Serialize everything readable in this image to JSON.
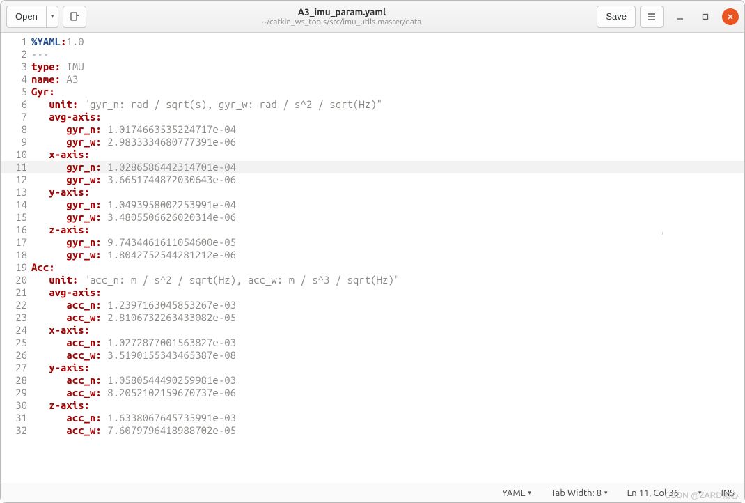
{
  "header": {
    "open": "Open",
    "save": "Save",
    "title": "A3_imu_param.yaml",
    "subtitle": "~/catkin_ws_tools/src/imu_utils-master/data"
  },
  "status": {
    "lang": "YAML",
    "tab": "Tab Width: 8",
    "pos": "Ln 11, Col 36",
    "ins": "INS"
  },
  "watermark": "CSDN @ZARD帧心",
  "code": {
    "directive": "%YAML",
    "version": "1.0",
    "dashes": "---",
    "type_k": "type",
    "type_v": "IMU",
    "name_k": "name",
    "name_v": "A3",
    "gyr": "Gyr",
    "acc": "Acc",
    "unit": "unit",
    "avg_axis": "avg-axis",
    "x_axis": "x-axis",
    "y_axis": "y-axis",
    "z_axis": "z-axis",
    "gyr_n": "gyr_n",
    "gyr_w": "gyr_w",
    "acc_n": "acc_n",
    "acc_w": "acc_w",
    "gyr_unit_str": "\"gyr_n: rad / sqrt(s), gyr_w: rad / s^2 / sqrt(Hz)\"",
    "acc_unit_str": "\"acc_n: m / s^2 / sqrt(Hz), acc_w: m / s^3 / sqrt(Hz)\"",
    "vals": {
      "g_avg_n": "1.0174663535224717e-04",
      "g_avg_w": "2.9833334680777391e-06",
      "g_x_n": "1.0286586442314701e-04",
      "g_x_w": "3.6651744872030643e-06",
      "g_y_n": "1.0493958002253991e-04",
      "g_y_w": "3.4805506626020314e-06",
      "g_z_n": "9.7434461611054600e-05",
      "g_z_w": "1.8042752544281212e-06",
      "a_avg_n": "1.2397163045853267e-03",
      "a_avg_w": "2.8106732263433082e-05",
      "a_x_n": "1.0272877001563827e-03",
      "a_x_w": "3.5190155343465387e-08",
      "a_y_n": "1.0580544490259981e-03",
      "a_y_w": "8.2052102159670737e-06",
      "a_z_n": "1.6338067645735991e-03",
      "a_z_w": "7.6079796418988702e-05"
    }
  }
}
